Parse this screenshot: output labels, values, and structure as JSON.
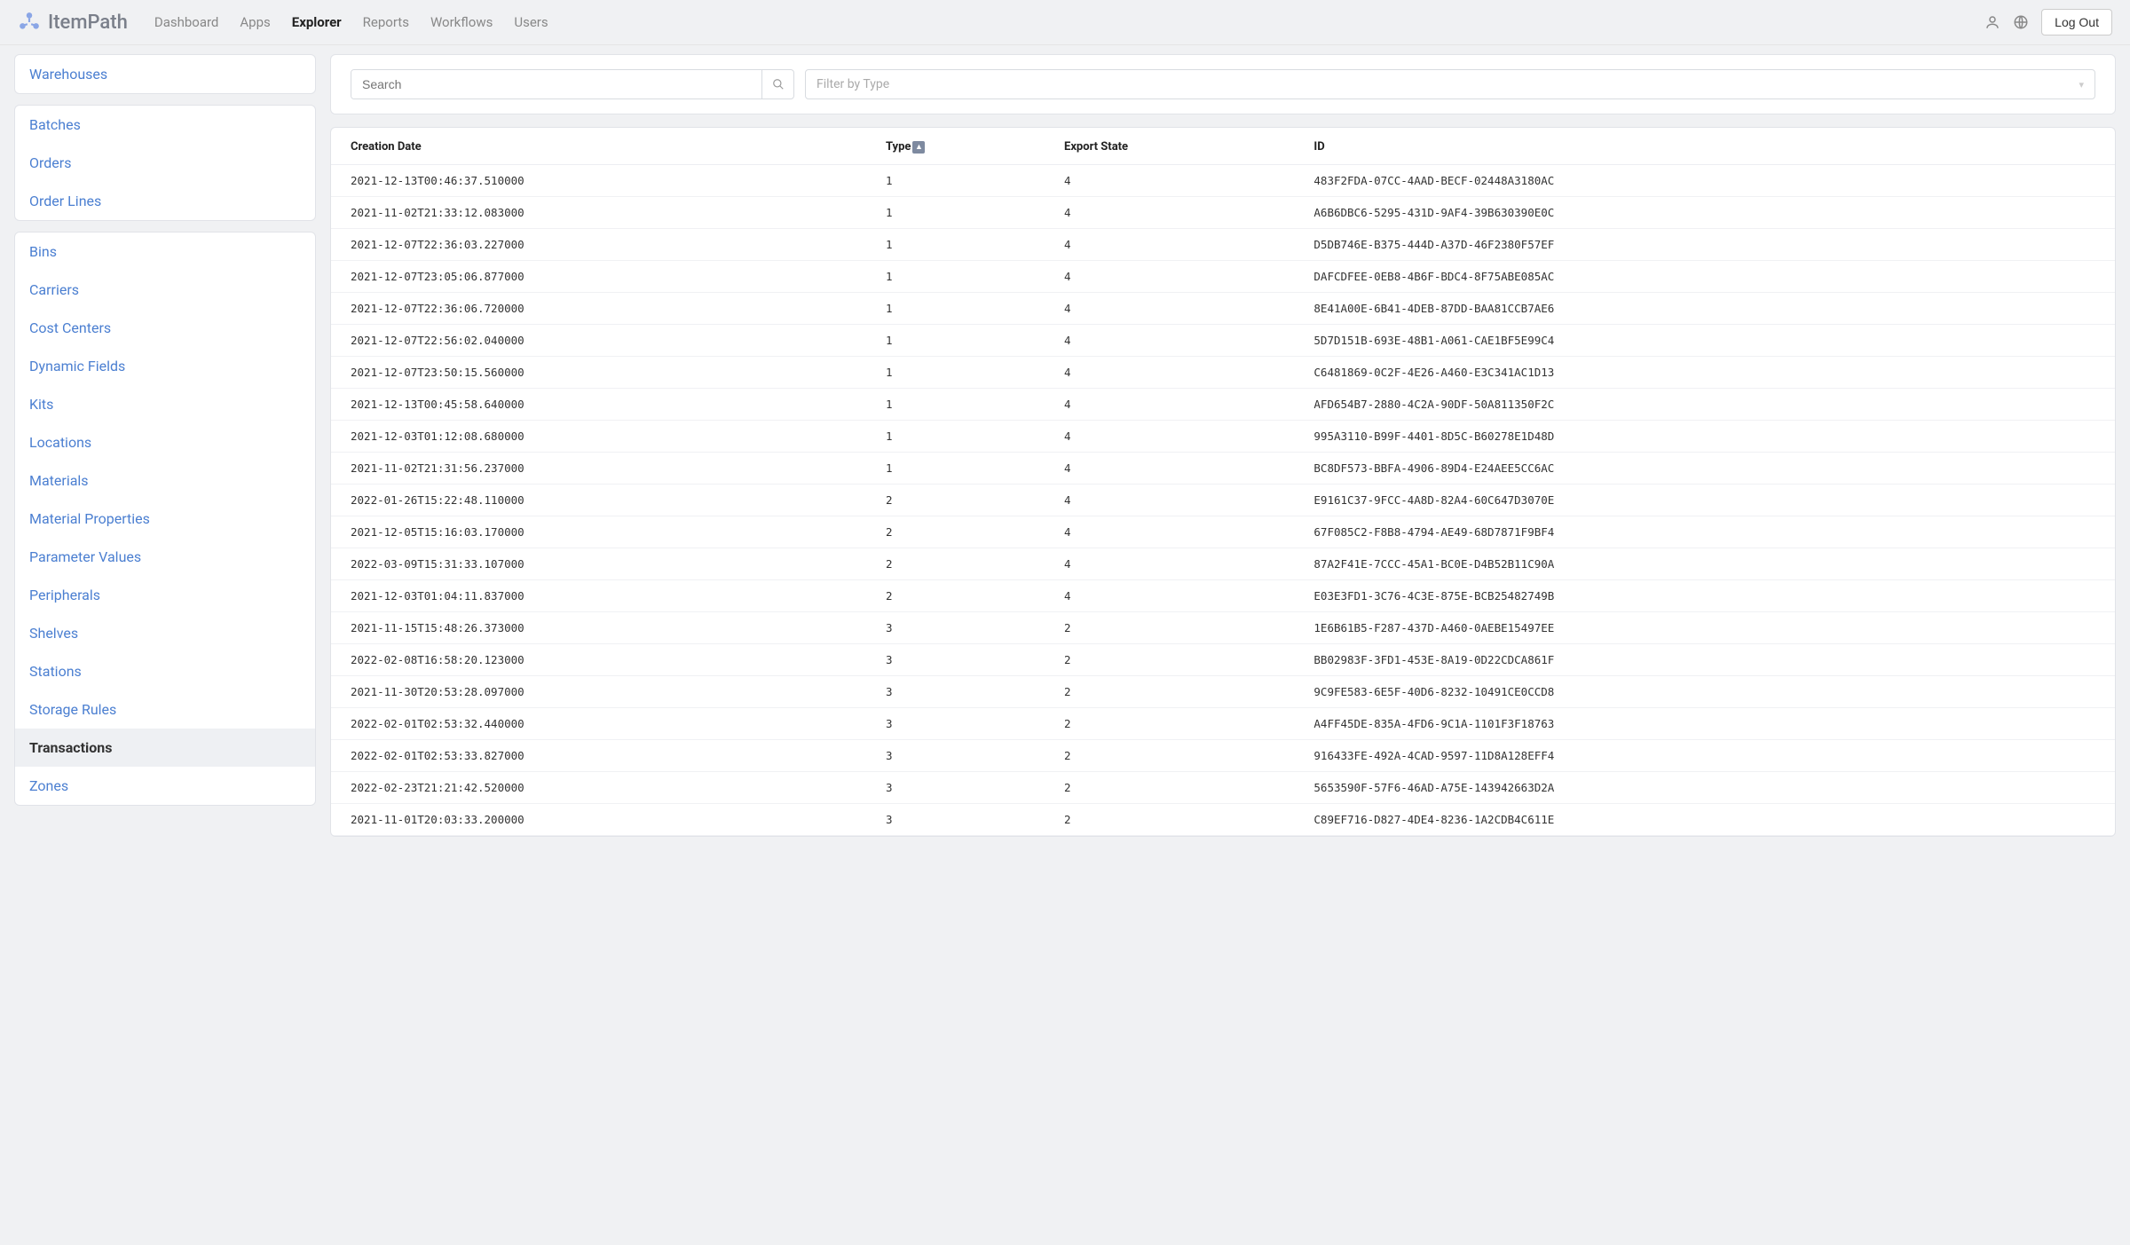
{
  "brand": "ItemPath",
  "nav": {
    "items": [
      {
        "label": "Dashboard",
        "active": false
      },
      {
        "label": "Apps",
        "active": false
      },
      {
        "label": "Explorer",
        "active": true
      },
      {
        "label": "Reports",
        "active": false
      },
      {
        "label": "Workflows",
        "active": false
      },
      {
        "label": "Users",
        "active": false
      }
    ],
    "logout": "Log Out"
  },
  "sidebar": {
    "groups": [
      {
        "items": [
          {
            "label": "Warehouses",
            "active": false
          }
        ]
      },
      {
        "items": [
          {
            "label": "Batches",
            "active": false
          },
          {
            "label": "Orders",
            "active": false
          },
          {
            "label": "Order Lines",
            "active": false
          }
        ]
      },
      {
        "items": [
          {
            "label": "Bins",
            "active": false
          },
          {
            "label": "Carriers",
            "active": false
          },
          {
            "label": "Cost Centers",
            "active": false
          },
          {
            "label": "Dynamic Fields",
            "active": false
          },
          {
            "label": "Kits",
            "active": false
          },
          {
            "label": "Locations",
            "active": false
          },
          {
            "label": "Materials",
            "active": false
          },
          {
            "label": "Material Properties",
            "active": false
          },
          {
            "label": "Parameter Values",
            "active": false
          },
          {
            "label": "Peripherals",
            "active": false
          },
          {
            "label": "Shelves",
            "active": false
          },
          {
            "label": "Stations",
            "active": false
          },
          {
            "label": "Storage Rules",
            "active": false
          },
          {
            "label": "Transactions",
            "active": true
          },
          {
            "label": "Zones",
            "active": false
          }
        ]
      }
    ]
  },
  "filters": {
    "search_placeholder": "Search",
    "type_placeholder": "Filter by Type"
  },
  "table": {
    "columns": [
      {
        "label": "Creation Date",
        "sorted": false
      },
      {
        "label": "Type",
        "sorted": true,
        "dir": "asc"
      },
      {
        "label": "Export State",
        "sorted": false
      },
      {
        "label": "ID",
        "sorted": false
      }
    ],
    "rows": [
      {
        "creation_date": "2021-12-13T00:46:37.510000",
        "type": "1",
        "export_state": "4",
        "id": "483F2FDA-07CC-4AAD-BECF-02448A3180AC"
      },
      {
        "creation_date": "2021-11-02T21:33:12.083000",
        "type": "1",
        "export_state": "4",
        "id": "A6B6DBC6-5295-431D-9AF4-39B630390E0C"
      },
      {
        "creation_date": "2021-12-07T22:36:03.227000",
        "type": "1",
        "export_state": "4",
        "id": "D5DB746E-B375-444D-A37D-46F2380F57EF"
      },
      {
        "creation_date": "2021-12-07T23:05:06.877000",
        "type": "1",
        "export_state": "4",
        "id": "DAFCDFEE-0EB8-4B6F-BDC4-8F75ABE085AC"
      },
      {
        "creation_date": "2021-12-07T22:36:06.720000",
        "type": "1",
        "export_state": "4",
        "id": "8E41A00E-6B41-4DEB-87DD-BAA81CCB7AE6"
      },
      {
        "creation_date": "2021-12-07T22:56:02.040000",
        "type": "1",
        "export_state": "4",
        "id": "5D7D151B-693E-48B1-A061-CAE1BF5E99C4"
      },
      {
        "creation_date": "2021-12-07T23:50:15.560000",
        "type": "1",
        "export_state": "4",
        "id": "C6481869-0C2F-4E26-A460-E3C341AC1D13"
      },
      {
        "creation_date": "2021-12-13T00:45:58.640000",
        "type": "1",
        "export_state": "4",
        "id": "AFD654B7-2880-4C2A-90DF-50A811350F2C"
      },
      {
        "creation_date": "2021-12-03T01:12:08.680000",
        "type": "1",
        "export_state": "4",
        "id": "995A3110-B99F-4401-8D5C-B60278E1D48D"
      },
      {
        "creation_date": "2021-11-02T21:31:56.237000",
        "type": "1",
        "export_state": "4",
        "id": "BC8DF573-BBFA-4906-89D4-E24AEE5CC6AC"
      },
      {
        "creation_date": "2022-01-26T15:22:48.110000",
        "type": "2",
        "export_state": "4",
        "id": "E9161C37-9FCC-4A8D-82A4-60C647D3070E"
      },
      {
        "creation_date": "2021-12-05T15:16:03.170000",
        "type": "2",
        "export_state": "4",
        "id": "67F085C2-F8B8-4794-AE49-68D7871F9BF4"
      },
      {
        "creation_date": "2022-03-09T15:31:33.107000",
        "type": "2",
        "export_state": "4",
        "id": "87A2F41E-7CCC-45A1-BC0E-D4B52B11C90A"
      },
      {
        "creation_date": "2021-12-03T01:04:11.837000",
        "type": "2",
        "export_state": "4",
        "id": "E03E3FD1-3C76-4C3E-875E-BCB25482749B"
      },
      {
        "creation_date": "2021-11-15T15:48:26.373000",
        "type": "3",
        "export_state": "2",
        "id": "1E6B61B5-F287-437D-A460-0AEBE15497EE"
      },
      {
        "creation_date": "2022-02-08T16:58:20.123000",
        "type": "3",
        "export_state": "2",
        "id": "BB02983F-3FD1-453E-8A19-0D22CDCA861F"
      },
      {
        "creation_date": "2021-11-30T20:53:28.097000",
        "type": "3",
        "export_state": "2",
        "id": "9C9FE583-6E5F-40D6-8232-10491CE0CCD8"
      },
      {
        "creation_date": "2022-02-01T02:53:32.440000",
        "type": "3",
        "export_state": "2",
        "id": "A4FF45DE-835A-4FD6-9C1A-1101F3F18763"
      },
      {
        "creation_date": "2022-02-01T02:53:33.827000",
        "type": "3",
        "export_state": "2",
        "id": "916433FE-492A-4CAD-9597-11D8A128EFF4"
      },
      {
        "creation_date": "2022-02-23T21:21:42.520000",
        "type": "3",
        "export_state": "2",
        "id": "5653590F-57F6-46AD-A75E-143942663D2A"
      },
      {
        "creation_date": "2021-11-01T20:03:33.200000",
        "type": "3",
        "export_state": "2",
        "id": "C89EF716-D827-4DE4-8236-1A2CDB4C611E"
      }
    ]
  }
}
